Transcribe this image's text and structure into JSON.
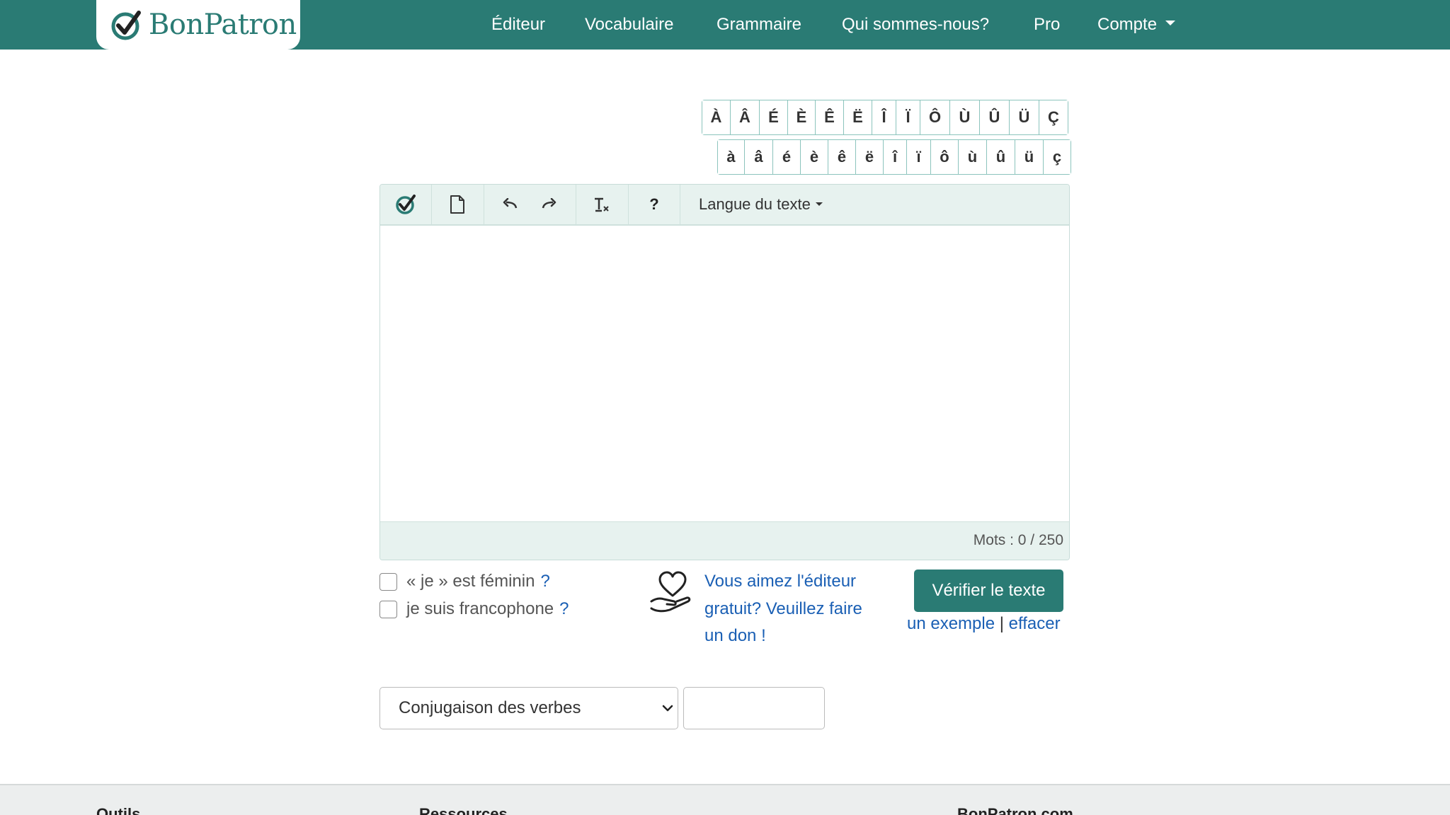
{
  "brand": {
    "name": "BonPatron"
  },
  "nav": {
    "items": [
      {
        "label": "Éditeur"
      },
      {
        "label": "Vocabulaire"
      },
      {
        "label": "Grammaire"
      },
      {
        "label": "Qui sommes-nous?"
      },
      {
        "label": "Pro"
      },
      {
        "label": "Compte"
      }
    ]
  },
  "accents": {
    "upper": [
      "À",
      "Â",
      "É",
      "È",
      "Ê",
      "Ë",
      "Î",
      "Ï",
      "Ô",
      "Ù",
      "Û",
      "Ü",
      "Ç"
    ],
    "lower": [
      "à",
      "â",
      "é",
      "è",
      "ê",
      "ë",
      "î",
      "ï",
      "ô",
      "ù",
      "û",
      "ü",
      "ç"
    ]
  },
  "toolbar": {
    "check_icon": "check-circle-icon",
    "new_icon": "new-document-icon",
    "undo_icon": "undo-icon",
    "redo_icon": "redo-icon",
    "clear_format_icon": "clear-format-icon",
    "help_label": "?",
    "language_label": "Langue du texte"
  },
  "editor": {
    "word_count": "Mots : 0 / 250"
  },
  "options": {
    "feminine_label": "« je » est féminin",
    "francophone_label": "je suis francophone",
    "help_mark": "?"
  },
  "donate": {
    "text": "Vous aimez l'éditeur gratuit? Veuillez faire un don !"
  },
  "actions": {
    "verify_label": "Vérifier le texte",
    "example_label": "un exemple",
    "separator": "|",
    "clear_label": "effacer"
  },
  "tools": {
    "selected": "Conjugaison des verbes",
    "input_value": ""
  },
  "footer": {
    "col1": "Outils",
    "col2": "Ressources",
    "col3": "BonPatron.com"
  },
  "colors": {
    "brand": "#2a7b74",
    "link": "#1a5fb4",
    "toolbar_bg": "#e7f2ef"
  }
}
